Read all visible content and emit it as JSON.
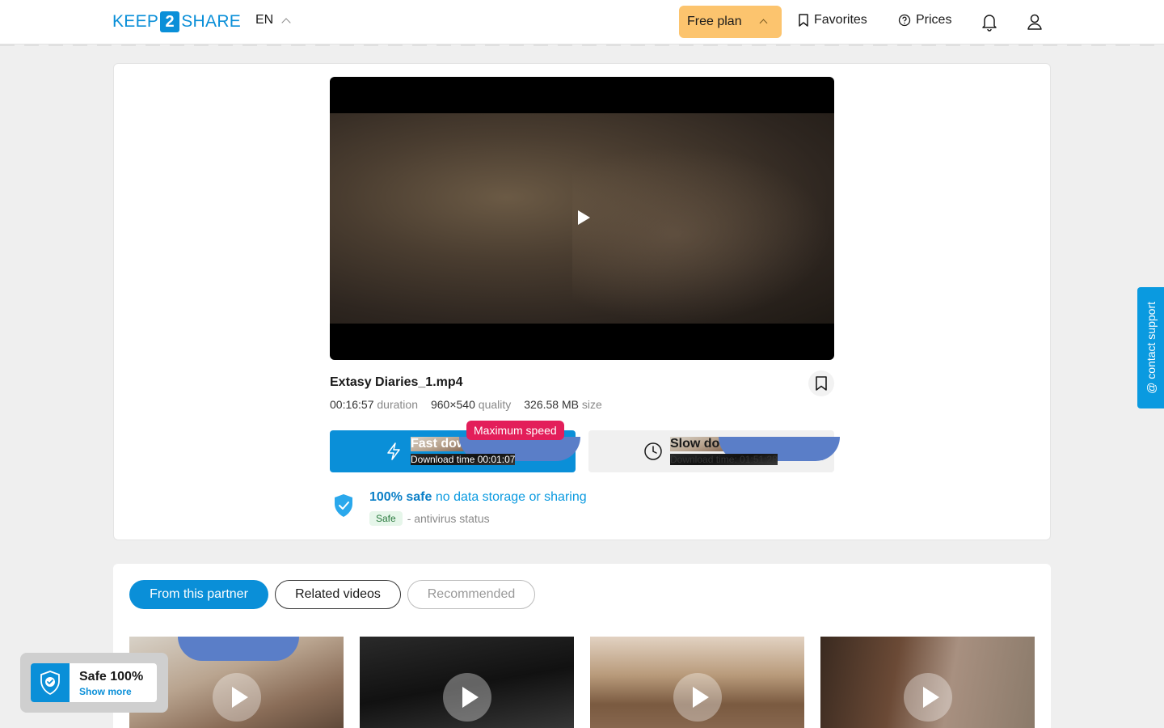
{
  "header": {
    "logo": {
      "pre": "KEEP",
      "mid": "2",
      "post": "SHARE"
    },
    "language": "EN",
    "plan_label": "Free plan",
    "favorites_label": "Favorites",
    "prices_label": "Prices"
  },
  "file": {
    "name": "Extasy Diaries_1.mp4",
    "duration_value": "00:16:57",
    "duration_label": "duration",
    "quality_value": "960×540",
    "quality_label": "quality",
    "size_value": "326.58 MB",
    "size_label": "size"
  },
  "download": {
    "fast_title": "Fast download",
    "fast_sub": "Download time 00:01:07",
    "max_speed_badge": "Maximum speed",
    "slow_title": "Slow download",
    "slow_sub": "Download time: 01:51:28"
  },
  "safety": {
    "bold": "100% safe",
    "note": "no data storage or sharing",
    "badge": "Safe",
    "av_label": "- antivirus status"
  },
  "support": {
    "label": "@ contact support"
  },
  "tabs": [
    {
      "label": "From this partner",
      "active": true
    },
    {
      "label": "Related videos",
      "active": false
    },
    {
      "label": "Recommended",
      "active": false
    }
  ],
  "widget": {
    "title": "Safe 100%",
    "link": "Show more"
  },
  "colors": {
    "accent": "#0a8fd8",
    "plan": "#fcc46e",
    "badge": "#e31e5a"
  }
}
